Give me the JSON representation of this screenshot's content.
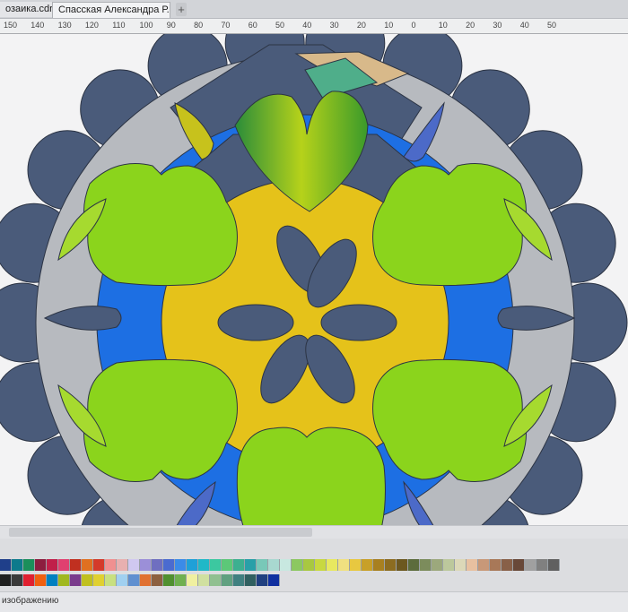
{
  "tabs": [
    {
      "label": "озаика.cdr*"
    },
    {
      "label": "Спасская Александра Р.*"
    }
  ],
  "tab_add_symbol": "+",
  "ruler_ticks": [
    "150",
    "140",
    "130",
    "120",
    "110",
    "100",
    "90",
    "80",
    "70",
    "60",
    "50",
    "40",
    "30",
    "20",
    "10",
    "0",
    "10",
    "20",
    "30",
    "40",
    "50"
  ],
  "status_text": "изображению",
  "colors": {
    "navy": "#4a5b7a",
    "grey": "#b7babf",
    "blue": "#1d6fe3",
    "yellow": "#e5c21a",
    "green": "#8bd41c",
    "green_light": "#a6da2f",
    "tan": "#d8b98a",
    "teal": "#4fae8a"
  },
  "palette_row1": [
    "#1f3f8a",
    "#0d7a8c",
    "#1b8f5a",
    "#8c1d3f",
    "#c01f4a",
    "#e04070",
    "#c03020",
    "#e07020",
    "#d43a2a",
    "#f09090",
    "#e8b0b0",
    "#d0c8f0",
    "#9b8fd8",
    "#6f6fc0",
    "#4b6bd0",
    "#3b8be8",
    "#1fa0d8",
    "#20b8c8",
    "#3cc8a0",
    "#5cc878",
    "#3cb090",
    "#28a0a8",
    "#78c8b8",
    "#a8d8d0",
    "#c8e8e0",
    "#8cc860",
    "#a8c840",
    "#c8d840",
    "#e8e860",
    "#f0e080",
    "#e8c840",
    "#c8a028",
    "#a88020",
    "#8c6c20",
    "#6c5820",
    "#5c6c3c",
    "#7c8c5c",
    "#9ca87c",
    "#bcc89c",
    "#dcd8b8",
    "#e8c0a0",
    "#c89878",
    "#a87858",
    "#886048",
    "#684838",
    "#a0a0a0",
    "#808080",
    "#606060"
  ],
  "palette_row2": [
    "#202020",
    "#3a3a3a",
    "#e02030",
    "#f06010",
    "#0080c0",
    "#a0b820",
    "#7a3c8c",
    "#c0c020",
    "#e0d030",
    "#c8e080",
    "#a0d0f0",
    "#6090d0",
    "#e07030",
    "#8c6040",
    "#509030",
    "#70b050",
    "#f0f0a0",
    "#d0e0a0",
    "#90c090",
    "#60a080",
    "#408080",
    "#306060",
    "#204080",
    "#1030a0"
  ]
}
